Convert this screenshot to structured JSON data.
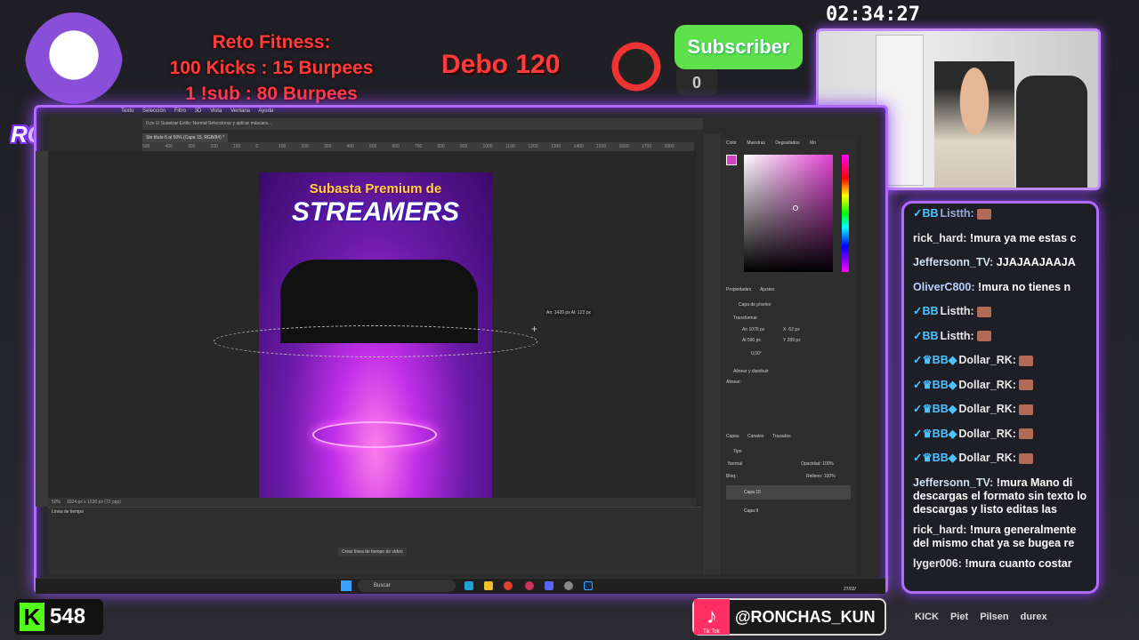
{
  "overlay": {
    "fitness_title": "Reto Fitness:",
    "fitness_line1": "100 Kicks : 15 Burpees",
    "fitness_line2": "1 !sub : 80 Burpees",
    "debo": "Debo 120",
    "subscriber_label": "Subscriber",
    "subscriber_count": "0",
    "timer": "02:34:27",
    "logo_text": "RONCHAS",
    "kick_count": "548",
    "tiktok_handle": "@RONCHAS_KUN",
    "tiktok_sub": "Tik Tok",
    "sponsors": [
      "KICK",
      "Piet",
      "Pilsen",
      "durex"
    ]
  },
  "chat": {
    "messages": [
      {
        "user": "Listth:",
        "badges": "✓BB",
        "text": "",
        "emote": true
      },
      {
        "user": "rick_hard:",
        "badges": "",
        "text": "!mura ya me estas c",
        "emote": false
      },
      {
        "user": "Jeffersonn_TV:",
        "badges": "",
        "text": "JJAJAAJAAJA",
        "emote": false
      },
      {
        "user": "OliverC800:",
        "badges": "",
        "text": "!mura no tienes n",
        "emote": false
      },
      {
        "user": "Listth:",
        "badges": "✓BB",
        "text": "",
        "emote": true
      },
      {
        "user": "Listth:",
        "badges": "✓BB",
        "text": "",
        "emote": true
      },
      {
        "user": "Dollar_RK:",
        "badges": "✓♛BB◆",
        "text": "",
        "emote": true
      },
      {
        "user": "Dollar_RK:",
        "badges": "✓♛BB◆",
        "text": "",
        "emote": true
      },
      {
        "user": "Dollar_RK:",
        "badges": "✓♛BB◆",
        "text": "",
        "emote": true
      },
      {
        "user": "Dollar_RK:",
        "badges": "✓♛BB◆",
        "text": "",
        "emote": true
      },
      {
        "user": "Dollar_RK:",
        "badges": "✓♛BB◆",
        "text": "",
        "emote": true
      }
    ],
    "wrapped": [
      {
        "user": "Jeffersonn_TV:",
        "text": "!mura Mano di descargas el formato sin texto lo descargas y listo editas las"
      },
      {
        "user": "rick_hard:",
        "text": "!mura generalmente del mismo chat ya se bugea re"
      },
      {
        "user": "lyger006:",
        "text": "!mura cuanto costar"
      }
    ]
  },
  "photoshop": {
    "menu": [
      "Texto",
      "Selección",
      "Filtro",
      "3D",
      "Vista",
      "Ventana",
      "Ayuda"
    ],
    "options_bar": "0 px   ☑ Suavizar   Estilo: Normal   Seleccionar y aplicar máscara...",
    "doc_tab": "Sin título-5 al 50% (Capa 15, RGB/8#) *",
    "ruler_ticks": [
      "500",
      "400",
      "300",
      "200",
      "100",
      "0",
      "100",
      "200",
      "300",
      "400",
      "500",
      "600",
      "700",
      "800",
      "900",
      "1000",
      "1100",
      "1200",
      "1300",
      "1400",
      "1500",
      "1600",
      "1700",
      "1800"
    ],
    "artboard_title1": "Subasta Premium de",
    "artboard_title2": "STREAMERS",
    "size_tooltip": "An: 1420 px  Al: 122 px",
    "status_zoom": "50%",
    "status_info": "1024 px x 1536 px (72 ppp)",
    "timeline_title": "Línea de tiempo",
    "timeline_button": "Crear línea de tiempo de vídeo",
    "color_tabs": [
      "Color",
      "Muestras",
      "Degradados",
      "Mo"
    ],
    "props_tabs": [
      "Propiedades",
      "Ajustes"
    ],
    "props_layer": "Capa de píxeles",
    "props_transform": "Transformar",
    "props_w": "An  1076 px",
    "props_x": "X  -52 px",
    "props_h": "Al  590 px",
    "props_y": "Y  289 px",
    "props_angle": "0,00°",
    "props_align": "Alinear y distribuir",
    "props_align_sub": "Alinear:",
    "layers_tabs": [
      "Capas",
      "Canales",
      "Trazados"
    ],
    "layers_kind": "Tipo",
    "layers_blend": "Normal",
    "layers_opacity": "Opacidad: 100%",
    "layers_lock": "Bloq.:",
    "layers_fill": "Relleno: 100%",
    "layers": [
      "Capa 15",
      "Capa 9"
    ]
  },
  "taskbar": {
    "search": "Buscar",
    "date": "27/02/"
  }
}
